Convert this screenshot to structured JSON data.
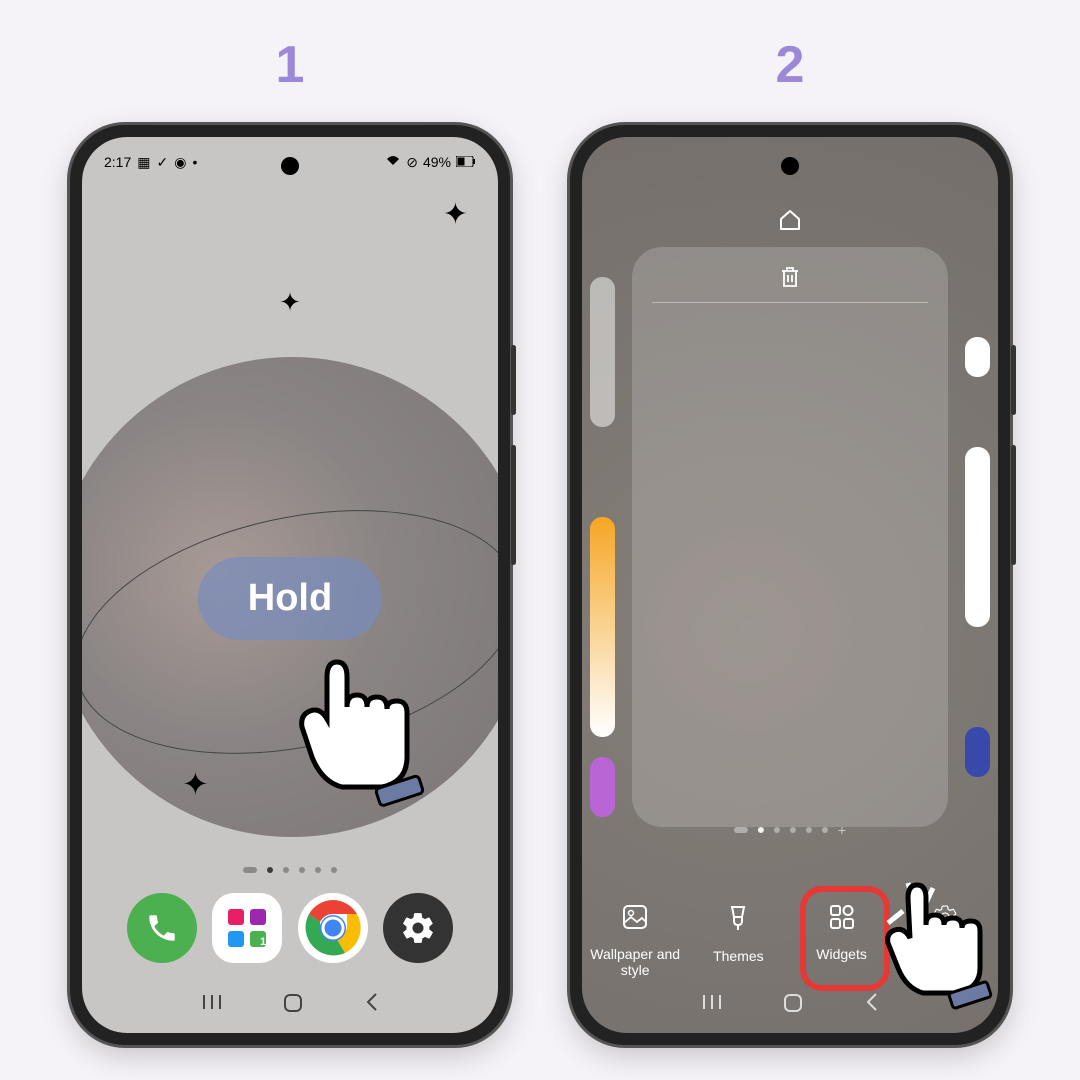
{
  "steps": [
    "1",
    "2"
  ],
  "phone1": {
    "status": {
      "time": "2:17",
      "battery": "49%"
    },
    "hold_label": "Hold",
    "dock": {
      "phone": "phone",
      "apps": "apps",
      "chrome": "chrome",
      "settings": "settings"
    },
    "nav": {
      "recents": "|||",
      "home": "⬭",
      "back": "‹"
    }
  },
  "phone2": {
    "menu": {
      "wallpaper": "Wallpaper and style",
      "themes": "Themes",
      "widgets": "Widgets",
      "settings": "Settings"
    },
    "nav": {
      "recents": "|||",
      "home": "⬭",
      "back": "‹"
    }
  }
}
